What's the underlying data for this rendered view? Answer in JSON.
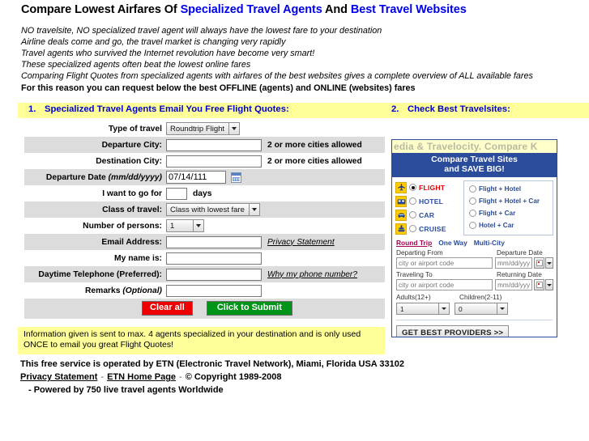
{
  "header": {
    "title_part1": "Compare Lowest Airfares Of ",
    "title_blue1": "Specialized Travel Agents",
    "title_part2": " And ",
    "title_blue2": "Best Travel Websites",
    "intro_lines": [
      "NO travelsite, NO specialized travel agent will always have the lowest fare to your destination",
      "Airline deals come and go, the travel market is changing very rapidly",
      "Travel agents who survived the Internet revolution have become very smart!",
      "These specialized agents often beat the lowest online fares",
      "Comparing Flight Quotes from specialized agents with airfares of the best websites gives a complete overview of ALL available fares"
    ],
    "intro_bold": "For this reason you can request below the best OFFLINE (agents) and ONLINE (websites) fares"
  },
  "sections": {
    "one_num": "1.",
    "one_label": "Specialized Travel Agents Email You Free Flight Quotes:",
    "two_num": "2.",
    "two_label": "Check Best Travelsites:"
  },
  "form": {
    "type_of_travel": {
      "label": "Type of travel",
      "value": "Roundtrip Flight"
    },
    "departure_city": {
      "label": "Departure City:",
      "value": "",
      "note": "2 or more cities allowed"
    },
    "destination_city": {
      "label": "Destination City:",
      "value": "",
      "note": "2 or more cities allowed"
    },
    "departure_date": {
      "label": "Departure Date ",
      "label_italic": "(mm/dd/yyyy)",
      "value": "07/14/111"
    },
    "go_for_days": {
      "label": "I want to go for",
      "value": "",
      "suffix": "days"
    },
    "class_of_travel": {
      "label": "Class of travel:",
      "value": "Class with lowest fare"
    },
    "number_of_persons": {
      "label": "Number of persons:",
      "value": "1"
    },
    "email_address": {
      "label": "Email Address:",
      "value": "",
      "link": "Privacy Statement"
    },
    "my_name": {
      "label": "My name is:",
      "value": ""
    },
    "telephone": {
      "label": "Daytime Telephone (Preferred):",
      "value": "",
      "link": "Why my phone number?"
    },
    "remarks": {
      "label": "Remarks ",
      "label_italic": "(Optional)",
      "value": ""
    },
    "clear_button": "Clear all",
    "submit_button": "Click to Submit"
  },
  "notice": "Information given is sent to max. 4 agents specialized in your destination and is only used ONCE to email you great Flight Quotes!",
  "footer": {
    "line1": "This free service is operated by ETN (Electronic Travel Network), Miami, Florida   USA 33102",
    "privacy_link": "Privacy Statement",
    "home_link": "ETN Home Page",
    "copyright": "© Copyright 1989-2008",
    "line3": "-   Powered by 750 live travel agents Worldwide"
  },
  "widget": {
    "marquee": "edia & Travelocity. Compare K",
    "head_line1": "Compare Travel Sites",
    "head_line2": "and SAVE BIG!",
    "types": [
      {
        "label": "FLIGHT",
        "icon": "plane-icon",
        "selected": true
      },
      {
        "label": "HOTEL",
        "icon": "hotel-icon",
        "selected": false
      },
      {
        "label": "CAR",
        "icon": "car-icon",
        "selected": false
      },
      {
        "label": "CRUISE",
        "icon": "cruise-icon",
        "selected": false
      }
    ],
    "combos": [
      {
        "label": "Flight + Hotel",
        "selected": false
      },
      {
        "label": "Flight + Hotel + Car",
        "selected": false
      },
      {
        "label": "Flight + Car",
        "selected": false
      },
      {
        "label": "Hotel + Car",
        "selected": false
      }
    ],
    "trip_tabs": [
      {
        "label": "Round Trip",
        "active": true
      },
      {
        "label": "One Way",
        "active": false
      },
      {
        "label": "Multi-City",
        "active": false
      }
    ],
    "departing_from_label": "Departing From",
    "departure_date_label": "Departure Date",
    "traveling_to_label": "Traveling To",
    "returning_date_label": "Returning Date",
    "city_placeholder": "city or airport code",
    "date_placeholder": "mm/dd/yyyy",
    "adults_label": "Adults(12+)",
    "children_label": "Children(2-11)",
    "adults_value": "1",
    "children_value": "0",
    "get_button": "GET BEST PROVIDERS >>"
  },
  "colors": {
    "accent_blue": "#0000cc",
    "band_yellow": "#ffff99",
    "widget_blue": "#2b4c9b",
    "clear_red": "#ee0000",
    "submit_green": "#009418",
    "icon_gold": "#ffcc00"
  }
}
